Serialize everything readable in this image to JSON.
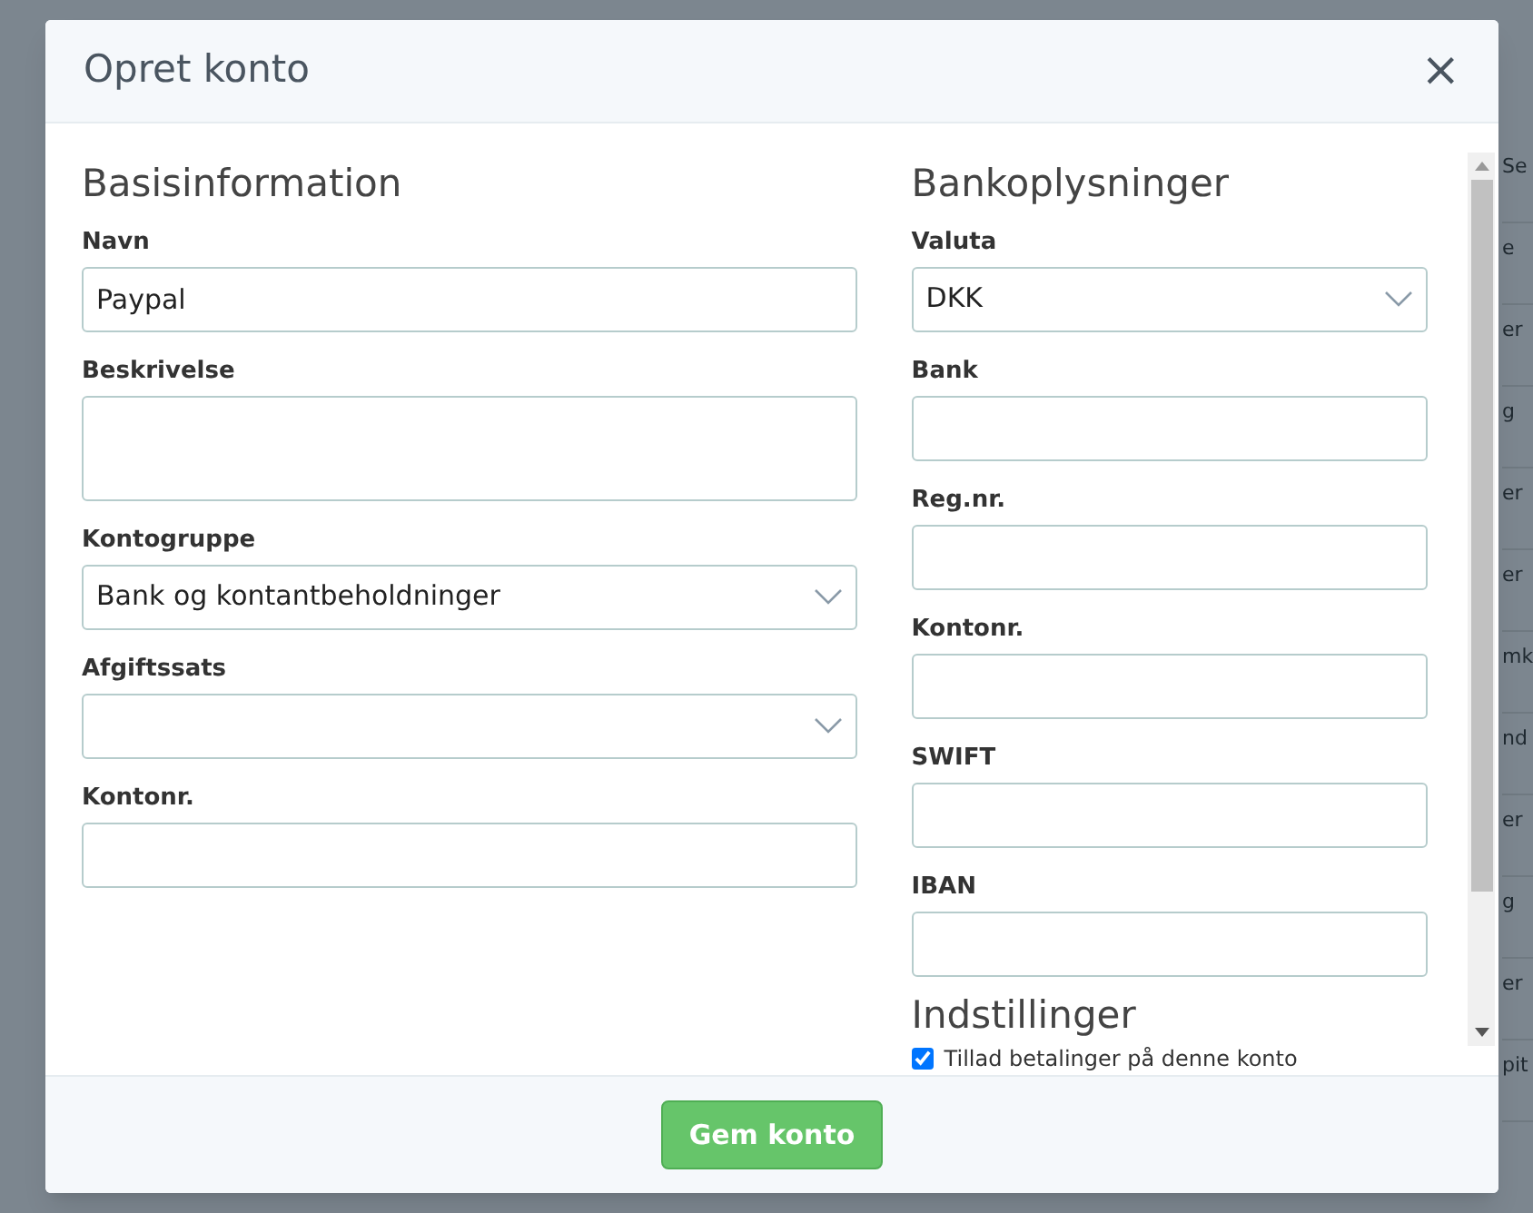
{
  "background": {
    "fragments": [
      "Se",
      "e",
      "er",
      "g",
      "er",
      "er",
      "mk",
      "nd",
      "er",
      "g",
      "er",
      "pit"
    ]
  },
  "dialog": {
    "title": "Opret konto",
    "close": "×",
    "left": {
      "heading": "Basisinformation",
      "fields": [
        {
          "kind": "input",
          "label": "Navn",
          "value": "Paypal"
        },
        {
          "kind": "textarea",
          "label": "Beskrivelse"
        },
        {
          "kind": "select",
          "label": "Kontogruppe",
          "value": "Bank og kontantbeholdninger"
        },
        {
          "kind": "select",
          "label": "Afgiftssats"
        },
        {
          "kind": "input",
          "label": "Kontonr."
        }
      ]
    },
    "right": {
      "heading": "Bankoplysninger",
      "fields": [
        {
          "kind": "select",
          "label": "Valuta",
          "value": "DKK"
        },
        {
          "kind": "input",
          "label": "Bank"
        },
        {
          "kind": "input",
          "label": "Reg.nr."
        },
        {
          "kind": "input",
          "label": "Kontonr."
        },
        {
          "kind": "input",
          "label": "SWIFT"
        },
        {
          "kind": "input",
          "label": "IBAN"
        }
      ]
    },
    "settings": {
      "heading": "Indstillinger",
      "options": [
        {
          "label": "Tillad betalinger på denne konto",
          "checked": true
        }
      ]
    },
    "save_button": "Gem konto"
  }
}
